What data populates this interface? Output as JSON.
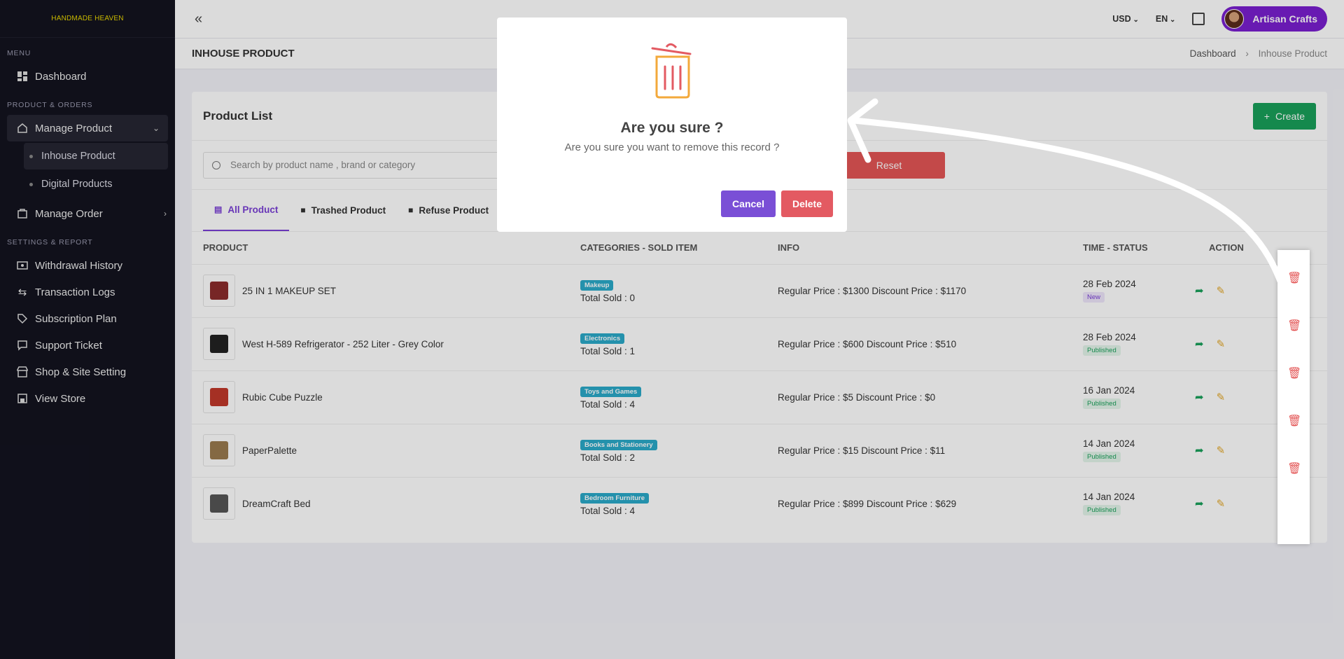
{
  "brand": "HANDMADE HEAVEN",
  "sidebar": {
    "menu_label": "MENU",
    "dashboard": "Dashboard",
    "product_orders_label": "PRODUCT & ORDERS",
    "manage_product": "Manage Product",
    "inhouse_product": "Inhouse Product",
    "digital_products": "Digital Products",
    "manage_order": "Manage Order",
    "settings_label": "SETTINGS & REPORT",
    "withdrawal_history": "Withdrawal History",
    "transaction_logs": "Transaction Logs",
    "subscription_plan": "Subscription Plan",
    "support_ticket": "Support Ticket",
    "shop_site_setting": "Shop & Site Setting",
    "view_store": "View Store"
  },
  "topbar": {
    "currency": "USD",
    "language": "EN",
    "user_name": "Artisan Crafts"
  },
  "page": {
    "title": "INHOUSE PRODUCT",
    "breadcrumb_home": "Dashboard",
    "breadcrumb_current": "Inhouse Product"
  },
  "card": {
    "title": "Product List",
    "create_label": "Create",
    "search_placeholder": "Search  by product name , brand or category",
    "reset_label": "Reset"
  },
  "tabs": {
    "all": "All Product",
    "trashed": "Trashed Product",
    "refuse": "Refuse Product"
  },
  "table": {
    "headers": {
      "product": "PRODUCT",
      "categories": "CATEGORIES - SOLD ITEM",
      "info": "INFO",
      "time": "TIME - STATUS",
      "action": "ACTION"
    },
    "rows": [
      {
        "name": "25 IN 1 MAKEUP SET",
        "category": "Makeup",
        "sold": "Total Sold : 0",
        "info": "Regular Price : $1300 Discount Price : $1170",
        "date": "28 Feb 2024",
        "status": "New",
        "status_type": "new",
        "thumb_color": "#8b2d2d"
      },
      {
        "name": "West H-589 Refrigerator - 252 Liter - Grey Color",
        "category": "Electronics",
        "sold": "Total Sold : 1",
        "info": "Regular Price : $600 Discount Price : $510",
        "date": "28 Feb 2024",
        "status": "Published",
        "status_type": "pub",
        "thumb_color": "#222222"
      },
      {
        "name": "Rubic Cube Puzzle",
        "category": "Toys and Games",
        "sold": "Total Sold : 4",
        "info": "Regular Price : $5 Discount Price : $0",
        "date": "16 Jan 2024",
        "status": "Published",
        "status_type": "pub",
        "thumb_color": "#c0392b"
      },
      {
        "name": "PaperPalette",
        "category": "Books and Stationery",
        "sold": "Total Sold : 2",
        "info": "Regular Price : $15 Discount Price : $11",
        "date": "14 Jan 2024",
        "status": "Published",
        "status_type": "pub",
        "thumb_color": "#9a7b4f"
      },
      {
        "name": "DreamCraft Bed",
        "category": "Bedroom Furniture",
        "sold": "Total Sold : 4",
        "info": "Regular Price : $899 Discount Price : $629",
        "date": "14 Jan 2024",
        "status": "Published",
        "status_type": "pub",
        "thumb_color": "#555555"
      }
    ]
  },
  "modal": {
    "title": "Are you sure ?",
    "text": "Are you sure you want to remove this record ?",
    "cancel_label": "Cancel",
    "delete_label": "Delete"
  },
  "colors": {
    "sidebar_bg": "#13131f",
    "accent_purple": "#7a3fd6",
    "create_green": "#19a05a",
    "danger_red": "#e35555"
  }
}
